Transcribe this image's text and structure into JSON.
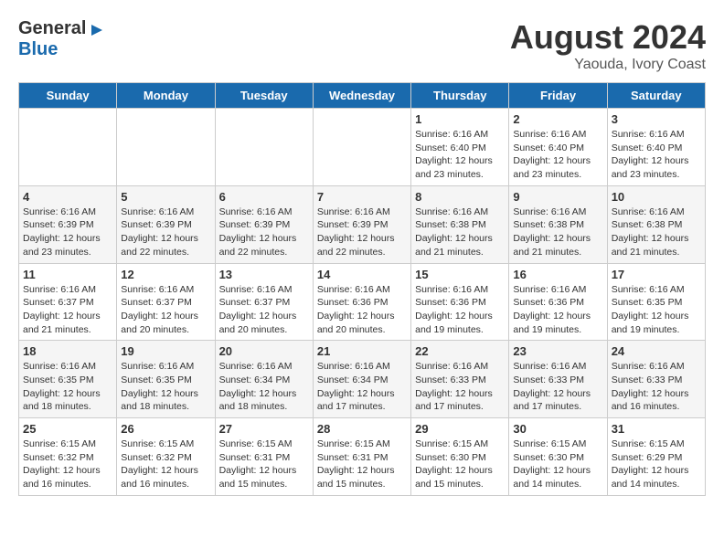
{
  "header": {
    "logo_general": "General",
    "logo_blue": "Blue",
    "title": "August 2024",
    "subtitle": "Yaouda, Ivory Coast"
  },
  "days_of_week": [
    "Sunday",
    "Monday",
    "Tuesday",
    "Wednesday",
    "Thursday",
    "Friday",
    "Saturday"
  ],
  "weeks": [
    [
      {
        "day": "",
        "info": ""
      },
      {
        "day": "",
        "info": ""
      },
      {
        "day": "",
        "info": ""
      },
      {
        "day": "",
        "info": ""
      },
      {
        "day": "1",
        "info": "Sunrise: 6:16 AM\nSunset: 6:40 PM\nDaylight: 12 hours\nand 23 minutes."
      },
      {
        "day": "2",
        "info": "Sunrise: 6:16 AM\nSunset: 6:40 PM\nDaylight: 12 hours\nand 23 minutes."
      },
      {
        "day": "3",
        "info": "Sunrise: 6:16 AM\nSunset: 6:40 PM\nDaylight: 12 hours\nand 23 minutes."
      }
    ],
    [
      {
        "day": "4",
        "info": "Sunrise: 6:16 AM\nSunset: 6:39 PM\nDaylight: 12 hours\nand 23 minutes."
      },
      {
        "day": "5",
        "info": "Sunrise: 6:16 AM\nSunset: 6:39 PM\nDaylight: 12 hours\nand 22 minutes."
      },
      {
        "day": "6",
        "info": "Sunrise: 6:16 AM\nSunset: 6:39 PM\nDaylight: 12 hours\nand 22 minutes."
      },
      {
        "day": "7",
        "info": "Sunrise: 6:16 AM\nSunset: 6:39 PM\nDaylight: 12 hours\nand 22 minutes."
      },
      {
        "day": "8",
        "info": "Sunrise: 6:16 AM\nSunset: 6:38 PM\nDaylight: 12 hours\nand 21 minutes."
      },
      {
        "day": "9",
        "info": "Sunrise: 6:16 AM\nSunset: 6:38 PM\nDaylight: 12 hours\nand 21 minutes."
      },
      {
        "day": "10",
        "info": "Sunrise: 6:16 AM\nSunset: 6:38 PM\nDaylight: 12 hours\nand 21 minutes."
      }
    ],
    [
      {
        "day": "11",
        "info": "Sunrise: 6:16 AM\nSunset: 6:37 PM\nDaylight: 12 hours\nand 21 minutes."
      },
      {
        "day": "12",
        "info": "Sunrise: 6:16 AM\nSunset: 6:37 PM\nDaylight: 12 hours\nand 20 minutes."
      },
      {
        "day": "13",
        "info": "Sunrise: 6:16 AM\nSunset: 6:37 PM\nDaylight: 12 hours\nand 20 minutes."
      },
      {
        "day": "14",
        "info": "Sunrise: 6:16 AM\nSunset: 6:36 PM\nDaylight: 12 hours\nand 20 minutes."
      },
      {
        "day": "15",
        "info": "Sunrise: 6:16 AM\nSunset: 6:36 PM\nDaylight: 12 hours\nand 19 minutes."
      },
      {
        "day": "16",
        "info": "Sunrise: 6:16 AM\nSunset: 6:36 PM\nDaylight: 12 hours\nand 19 minutes."
      },
      {
        "day": "17",
        "info": "Sunrise: 6:16 AM\nSunset: 6:35 PM\nDaylight: 12 hours\nand 19 minutes."
      }
    ],
    [
      {
        "day": "18",
        "info": "Sunrise: 6:16 AM\nSunset: 6:35 PM\nDaylight: 12 hours\nand 18 minutes."
      },
      {
        "day": "19",
        "info": "Sunrise: 6:16 AM\nSunset: 6:35 PM\nDaylight: 12 hours\nand 18 minutes."
      },
      {
        "day": "20",
        "info": "Sunrise: 6:16 AM\nSunset: 6:34 PM\nDaylight: 12 hours\nand 18 minutes."
      },
      {
        "day": "21",
        "info": "Sunrise: 6:16 AM\nSunset: 6:34 PM\nDaylight: 12 hours\nand 17 minutes."
      },
      {
        "day": "22",
        "info": "Sunrise: 6:16 AM\nSunset: 6:33 PM\nDaylight: 12 hours\nand 17 minutes."
      },
      {
        "day": "23",
        "info": "Sunrise: 6:16 AM\nSunset: 6:33 PM\nDaylight: 12 hours\nand 17 minutes."
      },
      {
        "day": "24",
        "info": "Sunrise: 6:16 AM\nSunset: 6:33 PM\nDaylight: 12 hours\nand 16 minutes."
      }
    ],
    [
      {
        "day": "25",
        "info": "Sunrise: 6:15 AM\nSunset: 6:32 PM\nDaylight: 12 hours\nand 16 minutes."
      },
      {
        "day": "26",
        "info": "Sunrise: 6:15 AM\nSunset: 6:32 PM\nDaylight: 12 hours\nand 16 minutes."
      },
      {
        "day": "27",
        "info": "Sunrise: 6:15 AM\nSunset: 6:31 PM\nDaylight: 12 hours\nand 15 minutes."
      },
      {
        "day": "28",
        "info": "Sunrise: 6:15 AM\nSunset: 6:31 PM\nDaylight: 12 hours\nand 15 minutes."
      },
      {
        "day": "29",
        "info": "Sunrise: 6:15 AM\nSunset: 6:30 PM\nDaylight: 12 hours\nand 15 minutes."
      },
      {
        "day": "30",
        "info": "Sunrise: 6:15 AM\nSunset: 6:30 PM\nDaylight: 12 hours\nand 14 minutes."
      },
      {
        "day": "31",
        "info": "Sunrise: 6:15 AM\nSunset: 6:29 PM\nDaylight: 12 hours\nand 14 minutes."
      }
    ]
  ]
}
